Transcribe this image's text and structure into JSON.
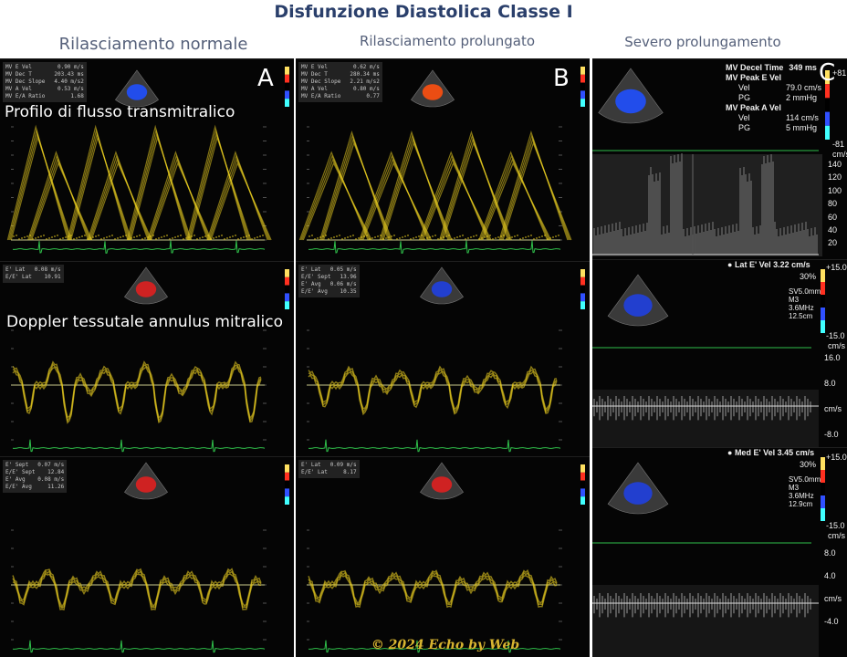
{
  "header": {
    "title": "Disfunzione Diastolica Classe I",
    "col_a": "Rilasciamento normale",
    "col_b": "Rilasciamento prolungato",
    "col_c": "Severo prolungamento"
  },
  "overlays": {
    "flow": "Profilo di flusso transmitralico",
    "tissue": "Doppler tessutale annulus mitralico"
  },
  "letters": {
    "a": "A",
    "b": "B",
    "c": "C"
  },
  "panel_c1": {
    "rows": [
      {
        "label": "MV Decel Time",
        "value": "349 ms"
      },
      {
        "label": "MV Peak E Vel",
        "value": ""
      },
      {
        "label": "Vel",
        "value": "79.0 cm/s"
      },
      {
        "label": "PG",
        "value": "2 mmHg"
      },
      {
        "label": "MV Peak A Vel",
        "value": ""
      },
      {
        "label": "Vel",
        "value": "114 cm/s"
      },
      {
        "label": "PG",
        "value": "5 mmHg"
      }
    ],
    "scale_ticks": [
      "140",
      "120",
      "100",
      "80",
      "60",
      "40",
      "20"
    ],
    "color_top": "+81",
    "color_bottom": "-81",
    "unit": "cm/s"
  },
  "panel_c2": {
    "label": "Lat E' Vel",
    "value": "3.22 cm/s",
    "pct": "30%",
    "settings": [
      "SV5.0mm",
      "M3",
      "3.6MHz",
      "12.5cm"
    ],
    "scale_ticks": [
      "16.0",
      "8.0",
      "cm/s",
      "-8.0"
    ],
    "color_top": "+15.0",
    "color_bottom": "-15.0",
    "unit": "cm/s"
  },
  "panel_c3": {
    "label": "Med E' Vel",
    "value": "3.45 cm/s",
    "pct": "30%",
    "settings": [
      "SV5.0mm",
      "M3",
      "3.6MHz",
      "12.9cm"
    ],
    "scale_ticks": [
      "8.0",
      "4.0",
      "cm/s",
      "-4.0"
    ],
    "color_top": "+15.0",
    "color_bottom": "-15.0",
    "unit": "cm/s"
  },
  "panel_a1": {
    "meas": [
      [
        "MV E Vel",
        "0.90 m/s"
      ],
      [
        "MV Dec T",
        "203.43 ms"
      ],
      [
        "MV Dec Slope",
        "4.40 m/s2"
      ],
      [
        "MV A Vel",
        "0.53 m/s"
      ],
      [
        "MV E/A Ratio",
        "1.68"
      ]
    ]
  },
  "panel_b1": {
    "meas": [
      [
        "MV E Vel",
        "0.62 m/s"
      ],
      [
        "MV Dec T",
        "280.34 ms"
      ],
      [
        "MV Dec Slope",
        "2.21 m/s2"
      ],
      [
        "MV A Vel",
        "0.80 m/s"
      ],
      [
        "MV E/A Ratio",
        "0.77"
      ]
    ]
  },
  "panel_a2": {
    "meas": [
      [
        "E' Lat",
        "0.08 m/s"
      ],
      [
        "E/E' Lat",
        "10.91"
      ]
    ]
  },
  "panel_b2": {
    "meas": [
      [
        "E' Lat",
        "0.05 m/s"
      ],
      [
        "E/E' Sept",
        "13.96"
      ],
      [
        "E' Avg",
        "0.06 m/s"
      ],
      [
        "E/E' Avg",
        "10.35"
      ]
    ]
  },
  "panel_a3": {
    "meas": [
      [
        "E' Sept",
        "0.07 m/s"
      ],
      [
        "E/E' Sept",
        "12.84"
      ],
      [
        "E' Avg",
        "0.08 m/s"
      ],
      [
        "E/E' Avg",
        "11.26"
      ]
    ]
  },
  "panel_b3": {
    "meas": [
      [
        "E' Lat",
        "0.09 m/s"
      ],
      [
        "E/E' Lat",
        "8.17"
      ]
    ]
  },
  "copyright": "© 2024 Echo by Web",
  "colors": {
    "trace": "#e8cc20",
    "ecg": "#2fbf4a",
    "baseline": "#c9c98a"
  }
}
